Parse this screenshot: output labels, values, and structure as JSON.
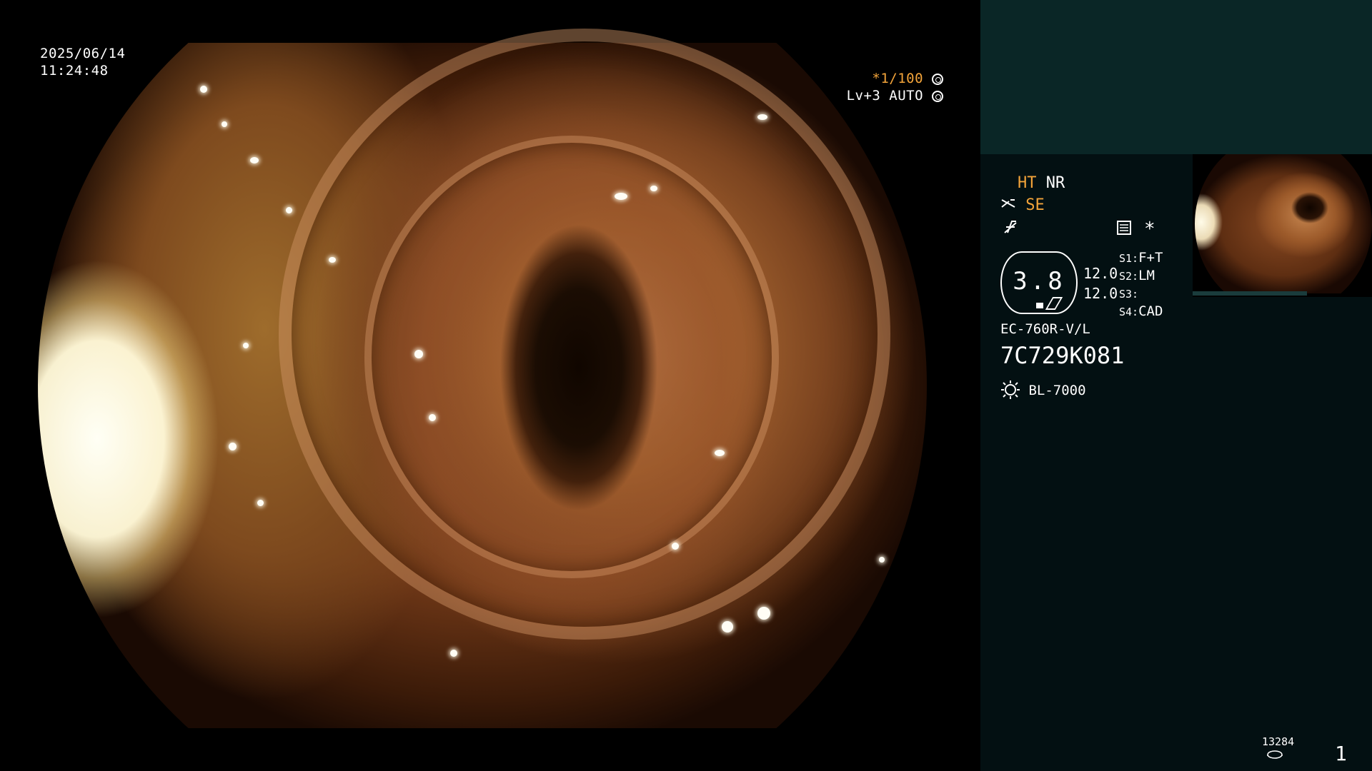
{
  "timestamp": {
    "date": "2025/06/14",
    "time": "11:24:48"
  },
  "view_settings": {
    "shutter": "*1/100",
    "level": "Lv+3",
    "mode": "AUTO"
  },
  "panel": {
    "modes": {
      "ht": "HT",
      "nr": "NR",
      "se": "SE"
    },
    "star_symbol": "*",
    "gauge_value": "3.8",
    "values": [
      "12.0",
      "12.0"
    ],
    "switches": [
      {
        "label": "S1:",
        "value": "F+T"
      },
      {
        "label": "S2:",
        "value": "LM"
      },
      {
        "label": "S3:",
        "value": ""
      },
      {
        "label": "S4:",
        "value": "CAD"
      }
    ],
    "scope_model": "EC-760R-V/L",
    "scope_serial": "7C729K081",
    "light_source": "BL-7000",
    "image_count": "13284",
    "page_number": "1"
  },
  "colors": {
    "accent": "#f3a43a",
    "panel_bg": "#031012",
    "panel_top_bg": "#0a2626"
  },
  "icons": [
    "shutter-icon",
    "iris-icon",
    "scissors-icon",
    "f-stroke-icon",
    "settings-card-icon",
    "light-bulb-icon",
    "disk-icon"
  ]
}
